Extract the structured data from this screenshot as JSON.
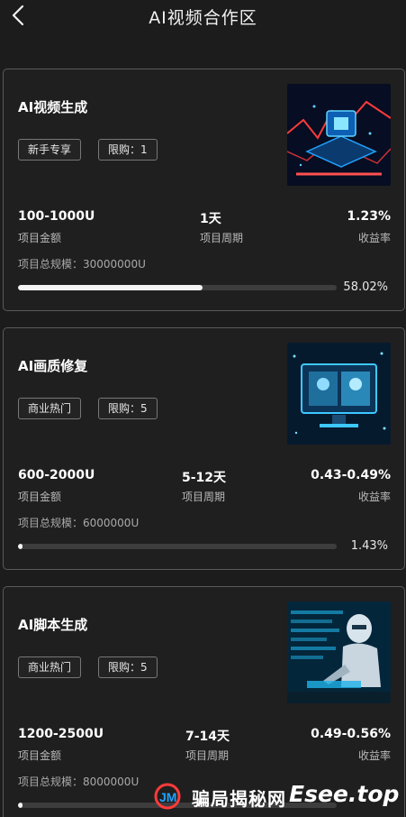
{
  "header": {
    "title": "AI视频合作区",
    "back_icon": "chevron-left-icon"
  },
  "cards": [
    {
      "title": "AI视频生成",
      "tags": [
        "新手专享",
        "限购：1"
      ],
      "amount": "100-1000U",
      "amount_label": "项目金额",
      "period": "1天",
      "period_label": "项目周期",
      "rate": "1.23%",
      "rate_label": "收益率",
      "scale": "项目总规模：30000000U",
      "progress": 58.02,
      "progress_text": "58.02%",
      "image": "ai-video-chip-icon"
    },
    {
      "title": "AI画质修复",
      "tags": [
        "商业热门",
        "限购：5"
      ],
      "amount": "600-2000U",
      "amount_label": "项目金额",
      "period": "5-12天",
      "period_label": "项目周期",
      "rate": "0.43-0.49%",
      "rate_label": "收益率",
      "scale": "项目总规模：6000000U",
      "progress": 1.43,
      "progress_text": "1.43%",
      "image": "image-restore-monitor-icon"
    },
    {
      "title": "AI脚本生成",
      "tags": [
        "商业热门",
        "限购：5"
      ],
      "amount": "1200-2500U",
      "amount_label": "项目金额",
      "period": "7-14天",
      "period_label": "项目周期",
      "rate": "0.49-0.56%",
      "rate_label": "收益率",
      "scale": "项目总规模：8000000U",
      "progress": 1.2,
      "progress_text": "",
      "image": "robot-typing-icon"
    }
  ],
  "watermark": {
    "text": "骗局揭秘网",
    "site": "Esee.top",
    "logo": "jm-logo-icon"
  },
  "colors": {
    "background": "#1c1c1c",
    "card_border": "#5a5a5a",
    "progress_fill": "#f4f4f4",
    "progress_track": "#3d3d3d",
    "accent_blue": "#1fa2ff",
    "accent_red": "#ff3b3b"
  }
}
